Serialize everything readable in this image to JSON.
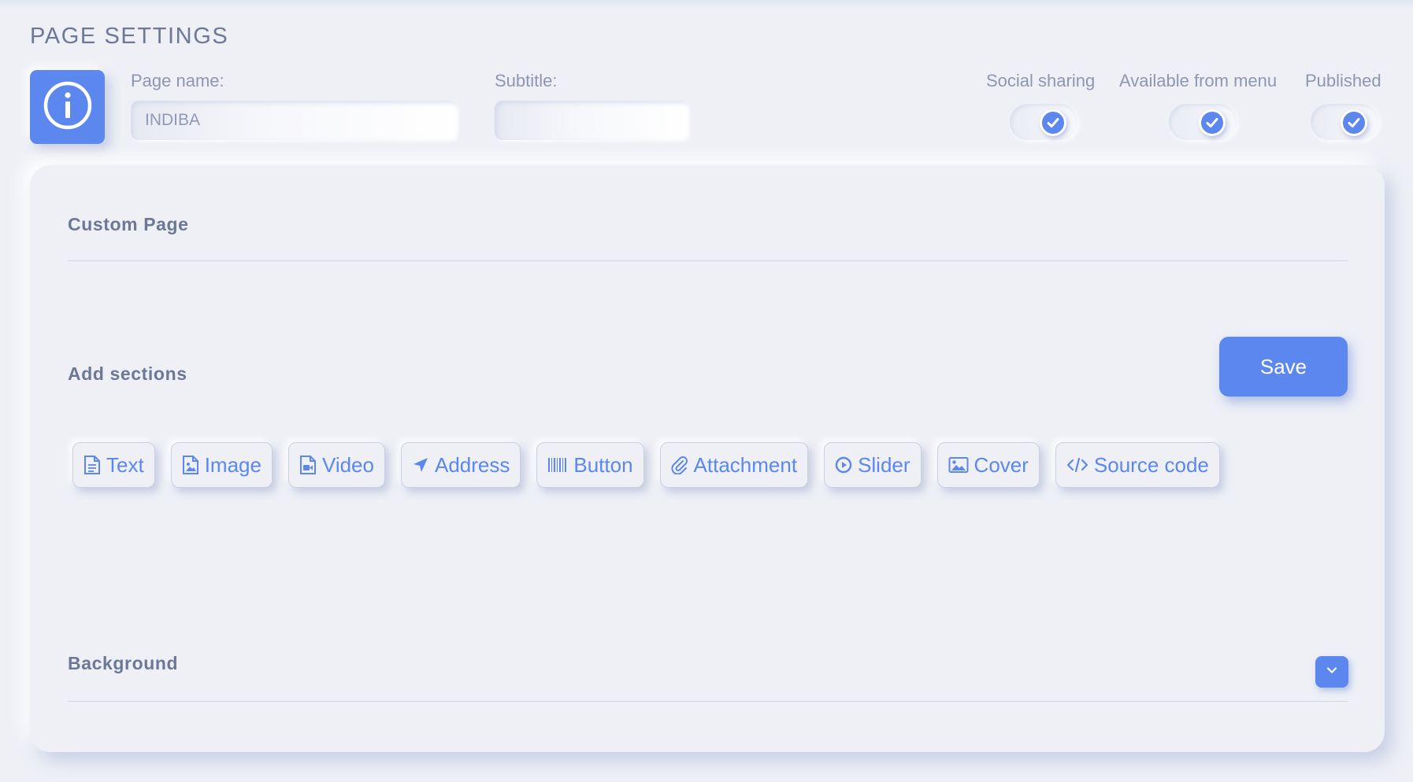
{
  "header": {
    "title": "PAGE SETTINGS",
    "info_icon": "info-circle-icon"
  },
  "form": {
    "page_name": {
      "label": "Page name:",
      "value": "INDIBA"
    },
    "subtitle": {
      "label": "Subtitle:",
      "value": ""
    }
  },
  "toggles": [
    {
      "label": "Social sharing",
      "checked": true
    },
    {
      "label": "Available from menu",
      "checked": true
    },
    {
      "label": "Published",
      "checked": true
    }
  ],
  "card": {
    "custom_page_heading": "Custom Page",
    "add_sections_heading": "Add sections",
    "save_label": "Save",
    "sections": [
      {
        "label": "Text",
        "icon": "file-text-icon"
      },
      {
        "label": "Image",
        "icon": "file-image-icon"
      },
      {
        "label": "Video",
        "icon": "file-video-icon"
      },
      {
        "label": "Address",
        "icon": "location-arrow-icon"
      },
      {
        "label": "Button",
        "icon": "barcode-icon"
      },
      {
        "label": "Attachment",
        "icon": "paperclip-icon"
      },
      {
        "label": "Slider",
        "icon": "play-circle-icon"
      },
      {
        "label": "Cover",
        "icon": "image-icon"
      },
      {
        "label": "Source code",
        "icon": "code-icon"
      }
    ],
    "background_heading": "Background",
    "background_toggle_icon": "chevron-down-icon"
  },
  "colors": {
    "accent": "#5b87ee",
    "background": "#eef0f6",
    "heading_text": "#6c7896",
    "label_text": "#8d97b3"
  }
}
